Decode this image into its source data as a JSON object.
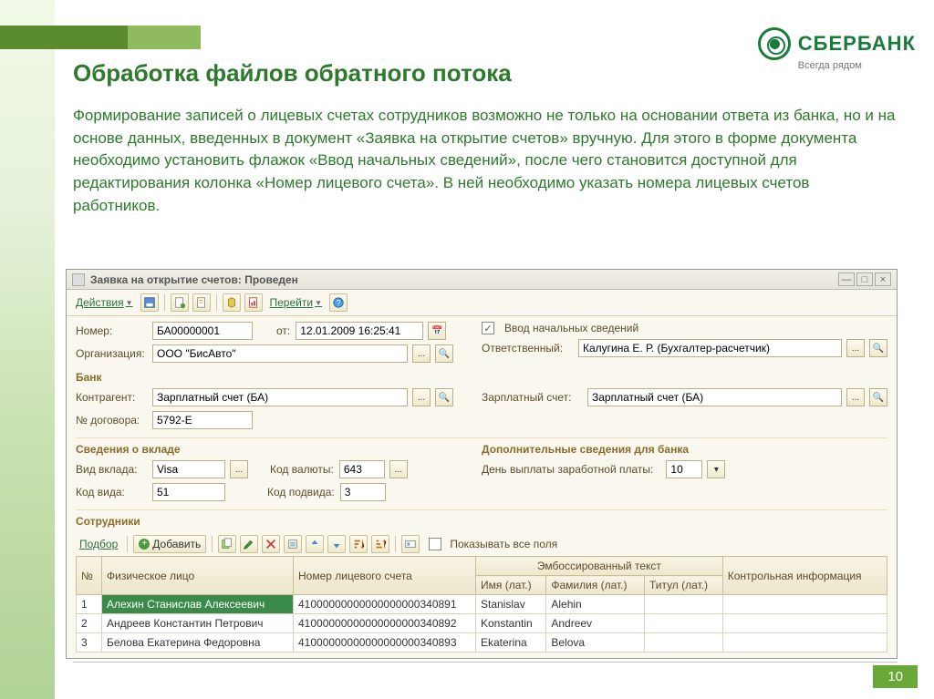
{
  "brand": {
    "name": "СБЕРБАНК",
    "tagline": "Всегда рядом"
  },
  "title": "Обработка файлов обратного потока",
  "paragraph": "Формирование записей о лицевых счетах сотрудников возможно не только на основании ответа из банка, но и на основе данных, введенных в документ «Заявка на открытие счетов» вручную. Для этого в форме документа необходимо установить флажок «Ввод начальных сведений», после чего становится доступной для редактирования колонка «Номер лицевого счета». В ней необходимо указать номера лицевых счетов работников.",
  "window": {
    "title": "Заявка на открытие счетов: Проведен",
    "toolbar": {
      "actions": "Действия",
      "goto": "Перейти"
    }
  },
  "form": {
    "number_label": "Номер:",
    "number": "БА00000001",
    "from_label": "от:",
    "from": "12.01.2009 16:25:41",
    "initial_check_label": "Ввод начальных сведений",
    "org_label": "Организация:",
    "org": "ООО \"БисАвто\"",
    "resp_label": "Ответственный:",
    "resp": "Калугина Е. Р. (Бухгалтер-расчетчик)",
    "bank_section": "Банк",
    "contragent_label": "Контрагент:",
    "contragent": "Зарплатный счет (БА)",
    "salary_acc_label": "Зарплатный счет:",
    "salary_acc": "Зарплатный счет (БА)",
    "contract_label": "№ договора:",
    "contract": "5792-E",
    "deposit_section": "Сведения о вкладе",
    "extra_section": "Дополнительные сведения для банка",
    "deposit_type_label": "Вид вклада:",
    "deposit_type": "Visa",
    "currency_label": "Код валюты:",
    "currency": "643",
    "payout_day_label": "День выплаты заработной платы:",
    "payout_day": "10",
    "kind_code_label": "Код вида:",
    "kind_code": "51",
    "subkind_label": "Код подвида:",
    "subkind": "3",
    "employees_section": "Сотрудники",
    "select_link": "Подбор",
    "add_button": "Добавить",
    "show_all_label": "Показывать все поля"
  },
  "table": {
    "headers": {
      "num": "№",
      "person": "Физическое лицо",
      "account": "Номер лицевого счета",
      "emboss": "Эмбоссированный текст",
      "name_lat": "Имя (лат.)",
      "surname_lat": "Фамилия (лат.)",
      "title_lat": "Титул (лат.)",
      "control": "Контрольная информация"
    },
    "rows": [
      {
        "n": "1",
        "person": "Алехин Станислав Алексеевич",
        "account": "41000000000000000000340891",
        "name": "Stanislav",
        "surname": "Alehin",
        "title": ""
      },
      {
        "n": "2",
        "person": "Андреев Константин Петрович",
        "account": "41000000000000000000340892",
        "name": "Konstantin",
        "surname": "Andreev",
        "title": ""
      },
      {
        "n": "3",
        "person": "Белова Екатерина Федоровна",
        "account": "41000000000000000000340893",
        "name": "Ekaterina",
        "surname": "Belova",
        "title": ""
      }
    ]
  },
  "page_number": "10"
}
